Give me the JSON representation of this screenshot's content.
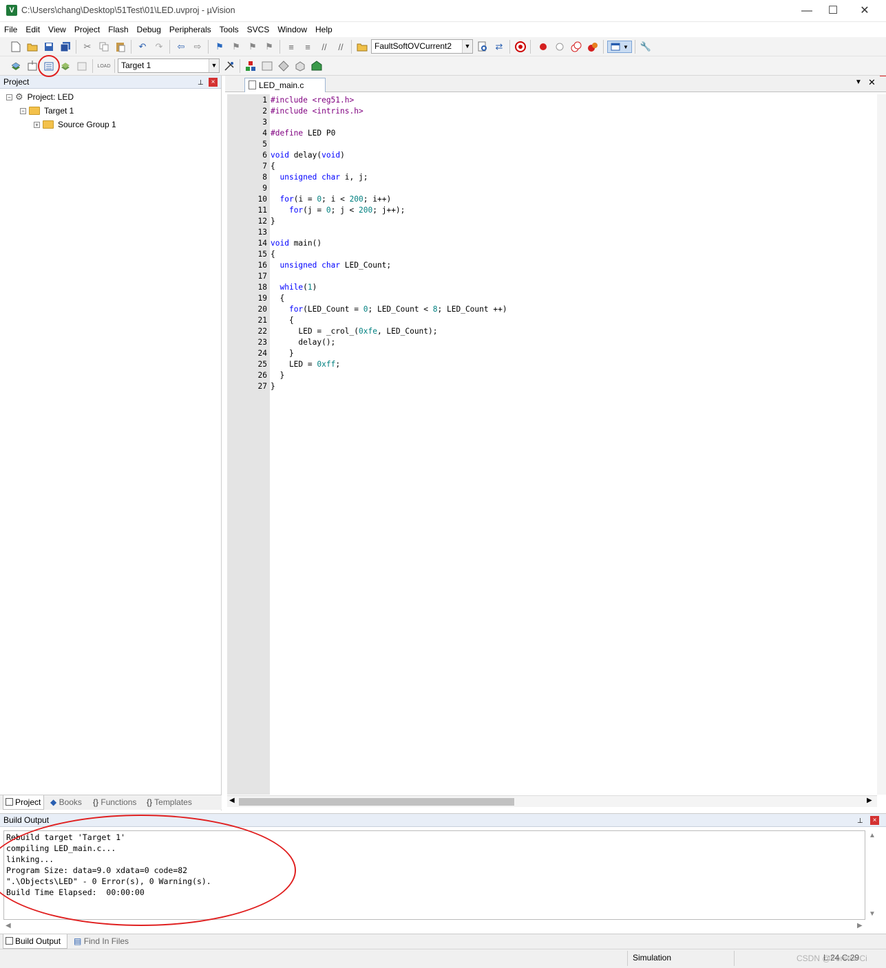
{
  "window": {
    "title": "C:\\Users\\chang\\Desktop\\51Test\\01\\LED.uvproj - µVision",
    "app_icon_letter": "V",
    "minimize": "—",
    "maximize": "☐",
    "close": "✕"
  },
  "menu": [
    "File",
    "Edit",
    "View",
    "Project",
    "Flash",
    "Debug",
    "Peripherals",
    "Tools",
    "SVCS",
    "Window",
    "Help"
  ],
  "toolbar": {
    "find_combo_value": "FaultSoftOVCurrent2",
    "target_combo_value": "Target 1"
  },
  "project_pane": {
    "title": "Project",
    "pin": "📌",
    "close": "×",
    "tree": {
      "project": "Project: LED",
      "target": "Target 1",
      "group": "Source Group 1"
    },
    "tabs": [
      "Project",
      "Books",
      "Functions",
      "Templates"
    ]
  },
  "editor": {
    "tab_label": "LED_main.c",
    "lines": [
      {
        "n": "1",
        "html": "<span class=\"inc\">#include &lt;reg51.h&gt;</span>"
      },
      {
        "n": "2",
        "html": "<span class=\"inc\">#include &lt;intrins.h&gt;</span>"
      },
      {
        "n": "3",
        "html": ""
      },
      {
        "n": "4",
        "html": "<span class=\"inc\">#define</span> LED P0"
      },
      {
        "n": "5",
        "html": ""
      },
      {
        "n": "6",
        "html": "<span class=\"kw\">void</span> delay(<span class=\"kw\">void</span>)"
      },
      {
        "n": "7",
        "html": "{"
      },
      {
        "n": "8",
        "html": "  <span class=\"kw\">unsigned char</span> i, j;"
      },
      {
        "n": "9",
        "html": ""
      },
      {
        "n": "10",
        "html": "  <span class=\"kw\">for</span>(i = <span class=\"num\">0</span>; i &lt; <span class=\"num\">200</span>; i++)"
      },
      {
        "n": "11",
        "html": "    <span class=\"kw\">for</span>(j = <span class=\"num\">0</span>; j &lt; <span class=\"num\">200</span>; j++);"
      },
      {
        "n": "12",
        "html": "}"
      },
      {
        "n": "13",
        "html": ""
      },
      {
        "n": "14",
        "html": "<span class=\"kw\">void</span> main()"
      },
      {
        "n": "15",
        "html": "{"
      },
      {
        "n": "16",
        "html": "  <span class=\"kw\">unsigned char</span> LED_Count;"
      },
      {
        "n": "17",
        "html": ""
      },
      {
        "n": "18",
        "html": "  <span class=\"kw\">while</span>(<span class=\"num\">1</span>)"
      },
      {
        "n": "19",
        "html": "  {"
      },
      {
        "n": "20",
        "html": "    <span class=\"kw\">for</span>(LED_Count = <span class=\"num\">0</span>; LED_Count &lt; <span class=\"num\">8</span>; LED_Count ++)"
      },
      {
        "n": "21",
        "html": "    {"
      },
      {
        "n": "22",
        "html": "      LED = _crol_(<span class=\"num\">0xfe</span>, LED_Count);"
      },
      {
        "n": "23",
        "html": "      delay();"
      },
      {
        "n": "24",
        "html": "    }"
      },
      {
        "n": "25",
        "html": "    LED = <span class=\"num\">0xff</span>;"
      },
      {
        "n": "26",
        "html": "  }"
      },
      {
        "n": "27",
        "html": "}"
      }
    ]
  },
  "build_output": {
    "title": "Build Output",
    "lines": [
      "Rebuild target 'Target 1'",
      "compiling LED_main.c...",
      "linking...",
      "Program Size: data=9.0 xdata=0 code=82",
      "\".\\Objects\\LED\" - 0 Error(s), 0 Warning(s).",
      "Build Time Elapsed:  00:00:00"
    ],
    "tabs": [
      "Build Output",
      "Find In Files"
    ]
  },
  "status": {
    "mode": "Simulation",
    "cursor": "L:24 C:29",
    "watermark": "CSDN @Forster-Ci"
  }
}
